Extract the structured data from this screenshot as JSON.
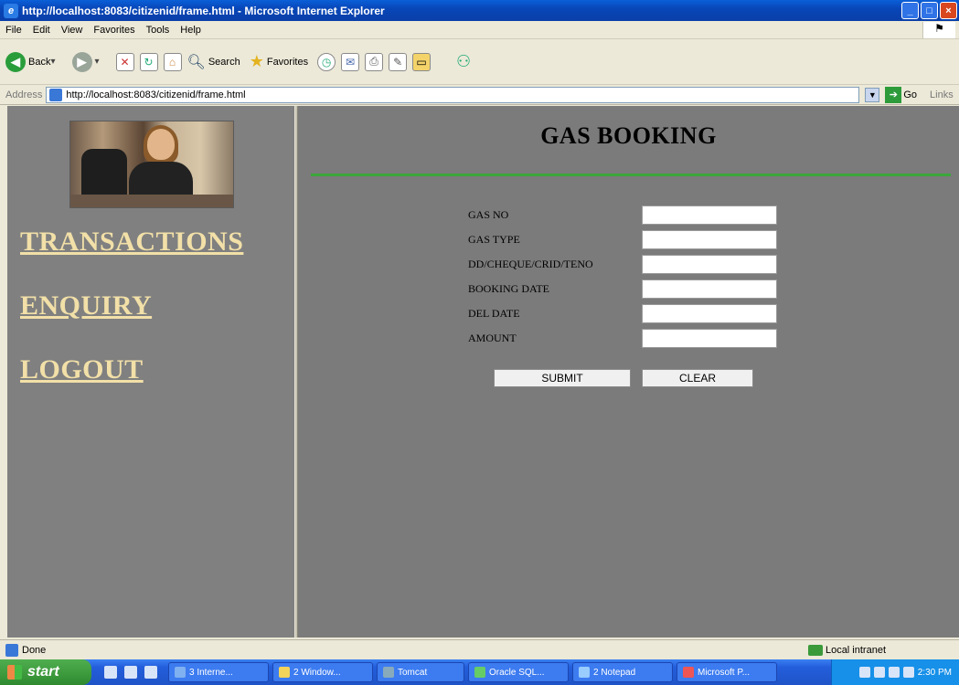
{
  "window": {
    "title": "http://localhost:8083/citizenid/frame.html - Microsoft Internet Explorer",
    "buttons": [
      "minimize-icon",
      "maximize-icon",
      "close-icon"
    ]
  },
  "menu": [
    "File",
    "Edit",
    "View",
    "Favorites",
    "Tools",
    "Help"
  ],
  "toolbar": {
    "back": "Back",
    "search": "Search",
    "favorites": "Favorites"
  },
  "address": {
    "label": "Address",
    "url": "http://localhost:8083/citizenid/frame.html",
    "go": "Go",
    "links": "Links"
  },
  "sidebar": {
    "links": [
      "TRANSACTIONS",
      "ENQUIRY",
      "LOGOUT"
    ]
  },
  "main": {
    "title": "GAS BOOKING",
    "fields": [
      {
        "label": "GAS NO",
        "value": ""
      },
      {
        "label": "GAS TYPE",
        "value": ""
      },
      {
        "label": "DD/CHEQUE/CRID/TENO",
        "value": ""
      },
      {
        "label": "BOOKING DATE",
        "value": ""
      },
      {
        "label": "DEL DATE",
        "value": ""
      },
      {
        "label": "AMOUNT",
        "value": ""
      }
    ],
    "submit_label": "SUBMIT",
    "clear_label": "CLEAR",
    "rule_color": "#3aa63a"
  },
  "status": {
    "text": "Done",
    "zone": "Local intranet"
  },
  "taskbar": {
    "start": "start",
    "tasks": [
      "3 Interne...",
      "2 Window...",
      "Tomcat",
      "Oracle SQL...",
      "2 Notepad",
      "Microsoft P..."
    ],
    "clock": "2:30 PM"
  }
}
